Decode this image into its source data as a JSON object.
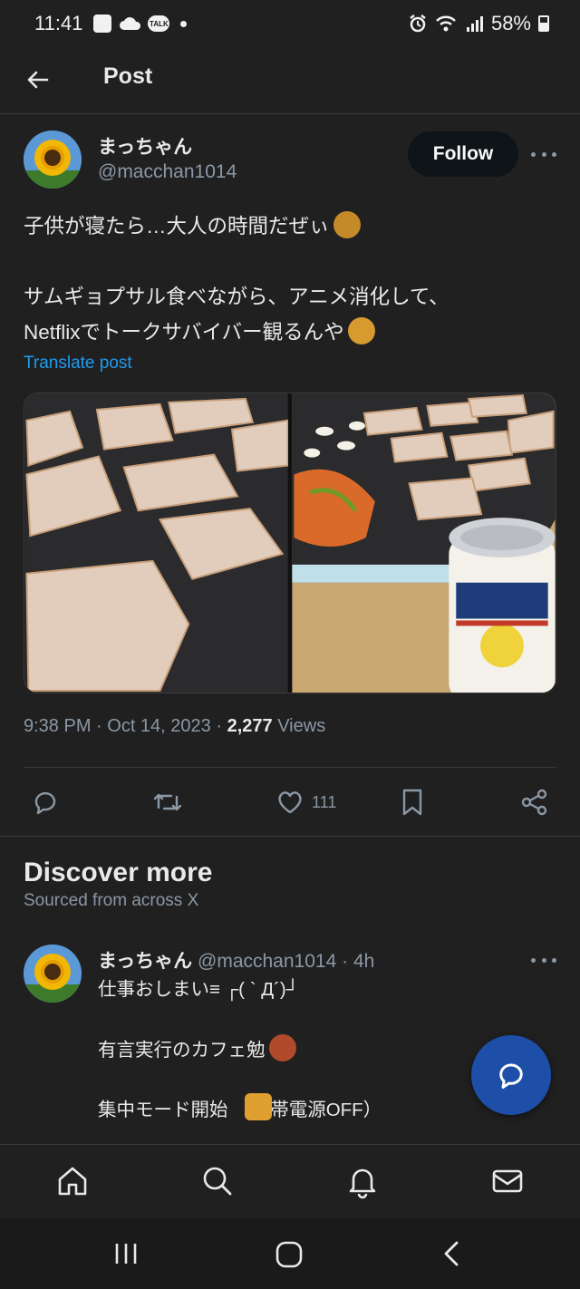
{
  "status_bar": {
    "time": "11:41",
    "talk_badge": "TALK",
    "battery": "58%"
  },
  "header": {
    "title": "Post"
  },
  "post": {
    "display_name": "まっちゃん",
    "handle": "@macchan1014",
    "follow_label": "Follow",
    "text_lines": [
      "子供が寝たら…大人の時間だぜぃ",
      "",
      "サムギョプサル食べながら、アニメ消化して、",
      "Netflixでトークサバイバー観るんや"
    ],
    "translate_label": "Translate post",
    "time": "9:38 PM",
    "date": "Oct 14, 2023",
    "views_count": "2,277",
    "views_label": "Views",
    "like_count": "111"
  },
  "discover": {
    "title": "Discover more",
    "subtitle": "Sourced from across X"
  },
  "tweet2": {
    "display_name": "まっちゃん",
    "handle": "@macchan1014",
    "age": "4h",
    "text_lines": [
      "仕事おしまい≡ ┌( ` Д´)┘",
      "",
      "有言実行のカフェ勉",
      "",
      "集中モード開始 （携帯電源OFF）"
    ]
  },
  "colors": {
    "background": "#202020",
    "accent": "#1d9bf0",
    "fab": "#1d4fa8",
    "secondary_text": "#8b98a5"
  },
  "icons": {
    "back": "arrow-left-icon",
    "reply": "reply-icon",
    "repost": "repost-icon",
    "like": "heart-icon",
    "bookmark": "bookmark-icon",
    "share": "share-icon",
    "fab": "compose-reply-icon",
    "home": "home-icon",
    "search": "search-icon",
    "notifications": "bell-icon",
    "messages": "mail-icon"
  }
}
